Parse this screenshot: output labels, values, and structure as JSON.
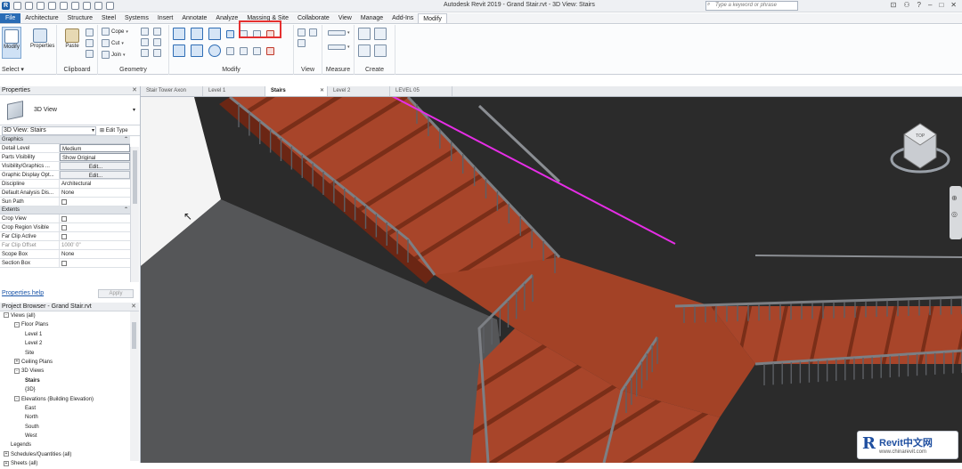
{
  "titlebar": {
    "title": "Autodesk Revit 2019 - Grand Stair.rvt - 3D View: Stairs",
    "search_placeholder": "Type a keyword or phrase",
    "app_logo": "R"
  },
  "ribbon_tabs": [
    "File",
    "Architecture",
    "Structure",
    "Steel",
    "Systems",
    "Insert",
    "Annotate",
    "Analyze",
    "Massing & Site",
    "Collaborate",
    "View",
    "Manage",
    "Add-Ins",
    "Modify"
  ],
  "active_tab": "Modify",
  "ribbon": {
    "select_label": "Select",
    "modify_btn": "Modify",
    "properties_btn": "Properties",
    "paste_btn": "Paste",
    "clipboard_label": "Clipboard",
    "cope": "Cope",
    "cut": "Cut",
    "join": "Join",
    "geometry_label": "Geometry",
    "modify_label": "Modify",
    "view_label": "View",
    "measure_label": "Measure",
    "create_label": "Create"
  },
  "properties": {
    "header": "Properties",
    "type_name": "3D View",
    "instance_selector": "3D View: Stairs",
    "edit_type": "Edit Type",
    "graphics_cat": "Graphics",
    "rows": [
      {
        "name": "Detail Level",
        "value": "Medium"
      },
      {
        "name": "Parts Visibility",
        "value": "Show Original"
      },
      {
        "name": "Visibility/Graphics ...",
        "value": "Edit..."
      },
      {
        "name": "Graphic Display Opt...",
        "value": "Edit..."
      },
      {
        "name": "Discipline",
        "value": "Architectural"
      },
      {
        "name": "Default Analysis Dis...",
        "value": "None"
      },
      {
        "name": "Sun Path",
        "value": ""
      }
    ],
    "extents_cat": "Extents",
    "extents_rows": [
      {
        "name": "Crop View",
        "value": ""
      },
      {
        "name": "Crop Region Visible",
        "value": ""
      },
      {
        "name": "Far Clip Active",
        "value": ""
      },
      {
        "name": "Far Clip Offset",
        "value": "1000' 0\""
      },
      {
        "name": "Scope Box",
        "value": "None"
      },
      {
        "name": "Section Box",
        "value": ""
      }
    ],
    "help_link": "Properties help",
    "apply": "Apply"
  },
  "browser": {
    "header": "Project Browser - Grand Stair.rvt",
    "nodes": [
      {
        "label": "Views (all)",
        "level": 0,
        "toggle": "-"
      },
      {
        "label": "Floor Plans",
        "level": 1,
        "toggle": "-"
      },
      {
        "label": "Level 1",
        "level": 2,
        "toggle": ""
      },
      {
        "label": "Level 2",
        "level": 2,
        "toggle": ""
      },
      {
        "label": "Site",
        "level": 2,
        "toggle": ""
      },
      {
        "label": "Ceiling Plans",
        "level": 1,
        "toggle": "+"
      },
      {
        "label": "3D Views",
        "level": 1,
        "toggle": "-"
      },
      {
        "label": "Stairs",
        "level": 2,
        "toggle": "",
        "bold": true
      },
      {
        "label": "{3D}",
        "level": 2,
        "toggle": ""
      },
      {
        "label": "Elevations (Building Elevation)",
        "level": 1,
        "toggle": "-"
      },
      {
        "label": "East",
        "level": 2,
        "toggle": ""
      },
      {
        "label": "North",
        "level": 2,
        "toggle": ""
      },
      {
        "label": "South",
        "level": 2,
        "toggle": ""
      },
      {
        "label": "West",
        "level": 2,
        "toggle": ""
      },
      {
        "label": "Legends",
        "level": 0,
        "toggle": ""
      },
      {
        "label": "Schedules/Quantities (all)",
        "level": 0,
        "toggle": "+"
      },
      {
        "label": "Sheets (all)",
        "level": 0,
        "toggle": "+"
      }
    ]
  },
  "view_tabs": [
    {
      "label": "Stair Tower Axon",
      "active": false
    },
    {
      "label": "Level 1",
      "active": false
    },
    {
      "label": "Stairs",
      "active": true
    },
    {
      "label": "Level 2",
      "active": false
    },
    {
      "label": "LEVEL 05",
      "active": false
    }
  ],
  "viewcube_label": "TOP",
  "watermark": {
    "brand": "Revit中文网",
    "url": "www.chinarevit.com"
  },
  "colors": {
    "accent": "#2a6cb5",
    "highlight": "#e53030",
    "annotation_arrow": "#e62de6",
    "stair_wood": "#a8452a",
    "canvas_dark": "#2b2b2b"
  }
}
